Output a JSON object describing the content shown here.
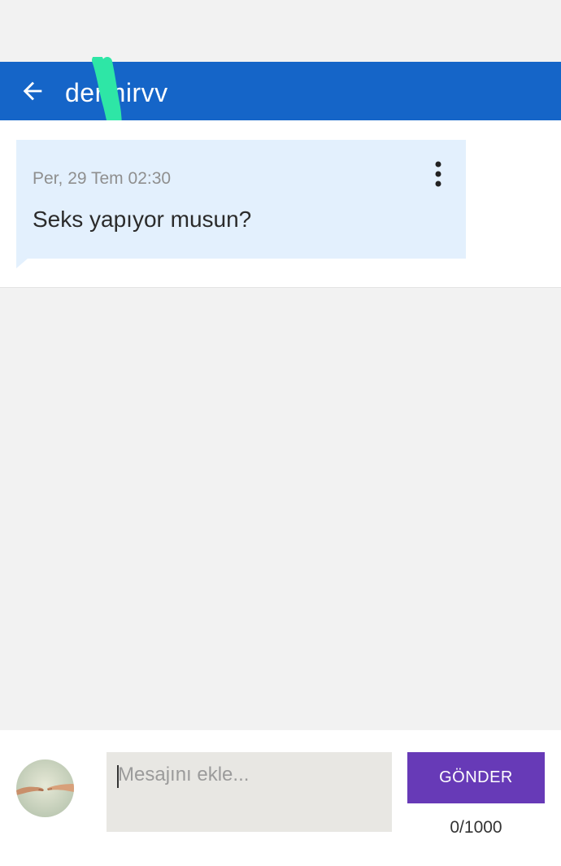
{
  "header": {
    "title": "dermirvv",
    "back_icon": "arrow-left-icon"
  },
  "message": {
    "timestamp": "Per, 29 Tem 02:30",
    "text": "Seks yapıyor musun?",
    "menu_icon": "more-vert-icon"
  },
  "composer": {
    "placeholder": "Mesajını ekle...",
    "value": "",
    "send_label": "GÖNDER",
    "counter": "0/1000"
  },
  "colors": {
    "app_bar": "#1565c8",
    "bubble": "#e3f0fd",
    "send_button": "#673ab7",
    "redaction": "#2ee6a6"
  }
}
